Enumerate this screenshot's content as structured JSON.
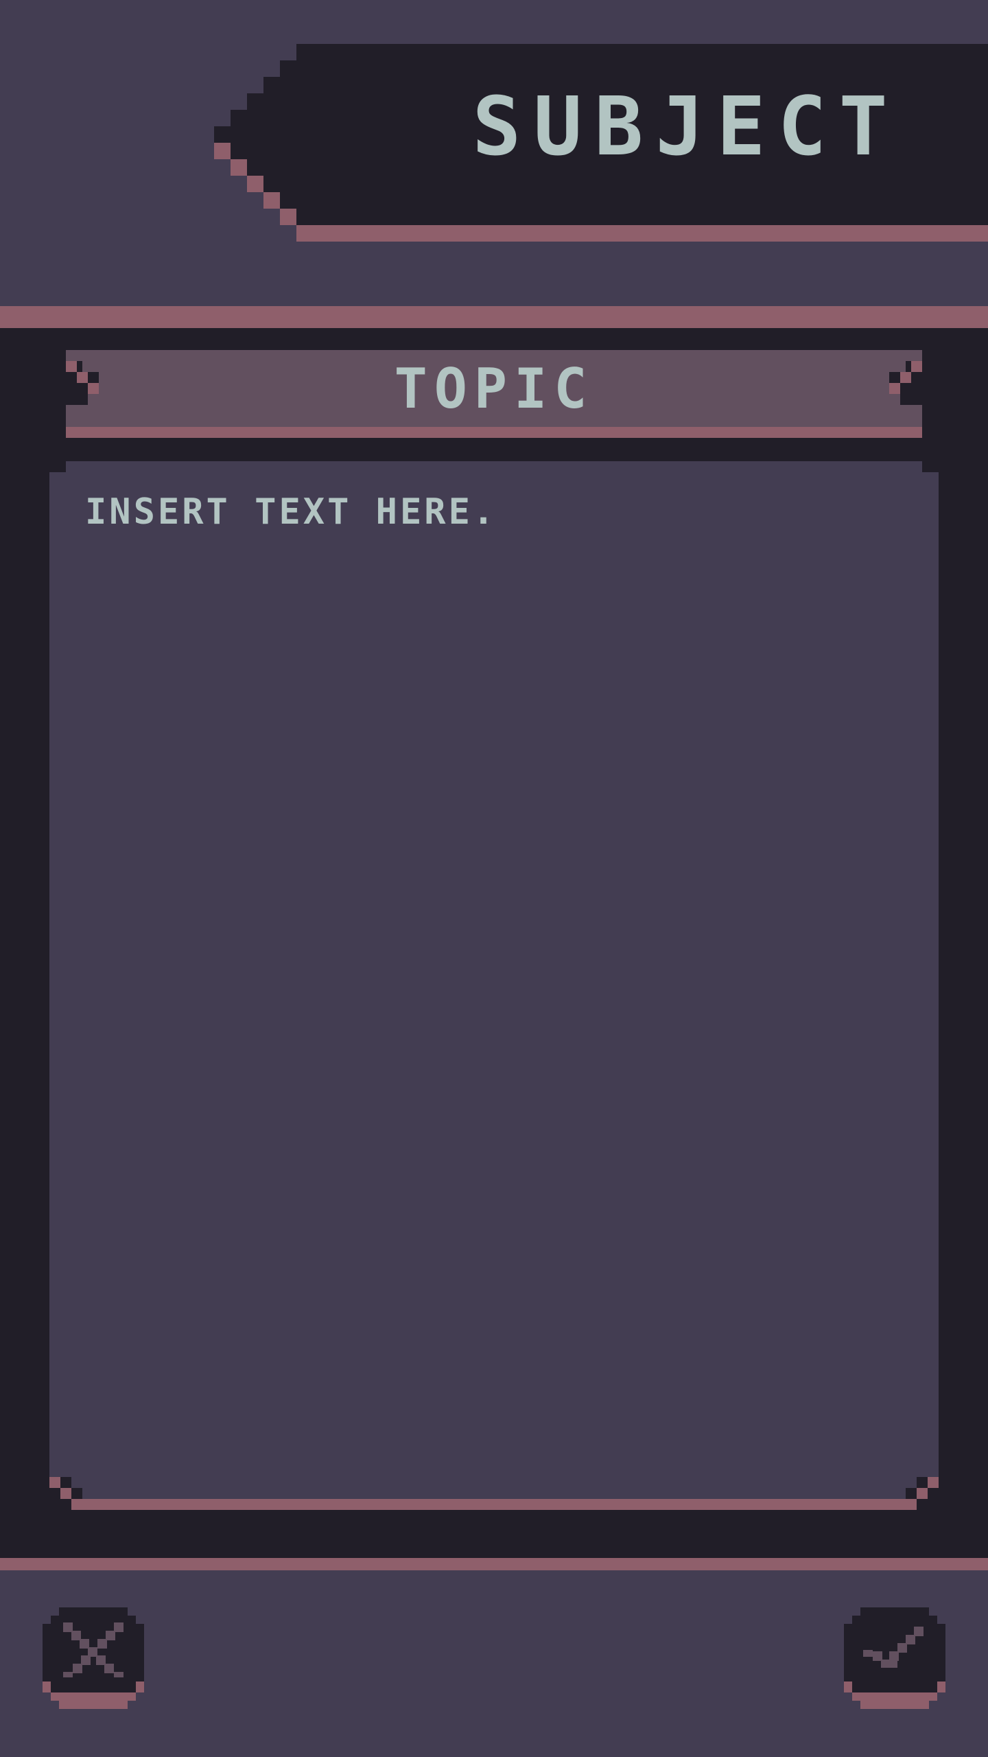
{
  "header": {
    "title": "SUBJECT"
  },
  "panel": {
    "topic_title": "TOPIC",
    "body_text": "INSERT TEXT HERE."
  },
  "buttons": {
    "cancel_icon": "close-icon",
    "confirm_icon": "checkmark-icon"
  },
  "colors": {
    "background": "#433d52",
    "panel_dark": "#211e28",
    "accent_rose": "#8f5f6b",
    "topic_fill": "#62505f",
    "text": "#b2c4c2"
  }
}
